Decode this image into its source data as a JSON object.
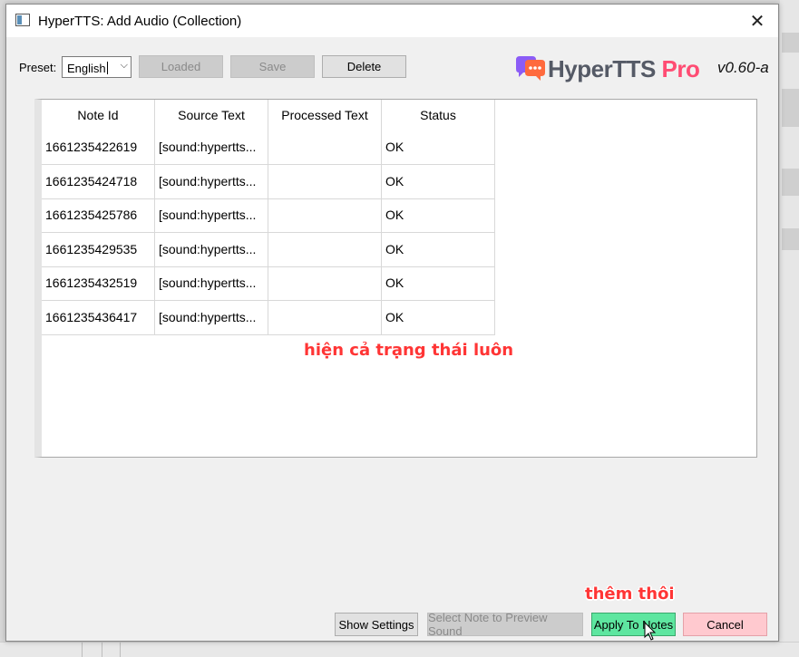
{
  "window": {
    "title": "HyperTTS: Add Audio (Collection)"
  },
  "toolbar": {
    "preset_label": "Preset:",
    "preset_value": "English",
    "loaded_label": "Loaded",
    "save_label": "Save",
    "delete_label": "Delete"
  },
  "logo": {
    "hyper": "HyperTTS",
    "pro": "Pro",
    "version": "v0.60-a"
  },
  "table": {
    "columns": [
      "Note Id",
      "Source Text",
      "Processed Text",
      "Status"
    ],
    "rows": [
      {
        "note_id": "1661235422619",
        "source": "[sound:hypertts...",
        "processed": "",
        "status": "OK"
      },
      {
        "note_id": "1661235424718",
        "source": "[sound:hypertts...",
        "processed": "",
        "status": "OK"
      },
      {
        "note_id": "1661235425786",
        "source": "[sound:hypertts...",
        "processed": "",
        "status": "OK"
      },
      {
        "note_id": "1661235429535",
        "source": "[sound:hypertts...",
        "processed": "",
        "status": "OK"
      },
      {
        "note_id": "1661235432519",
        "source": "[sound:hypertts...",
        "processed": "",
        "status": "OK"
      },
      {
        "note_id": "1661235436417",
        "source": "[sound:hypertts...",
        "processed": "",
        "status": "OK"
      }
    ]
  },
  "annotations": {
    "status_note": "hiện cả trạng thái luôn",
    "apply_note": "thêm thôi"
  },
  "footer": {
    "show_settings": "Show Settings",
    "preview": "Select Note to Preview Sound",
    "apply": "Apply To Notes",
    "cancel": "Cancel"
  },
  "colors": {
    "apply_bg": "#5ee6a0",
    "cancel_bg": "#ffc9cf",
    "annotation": "#ff3535",
    "logo_pro": "#ff4c73"
  }
}
